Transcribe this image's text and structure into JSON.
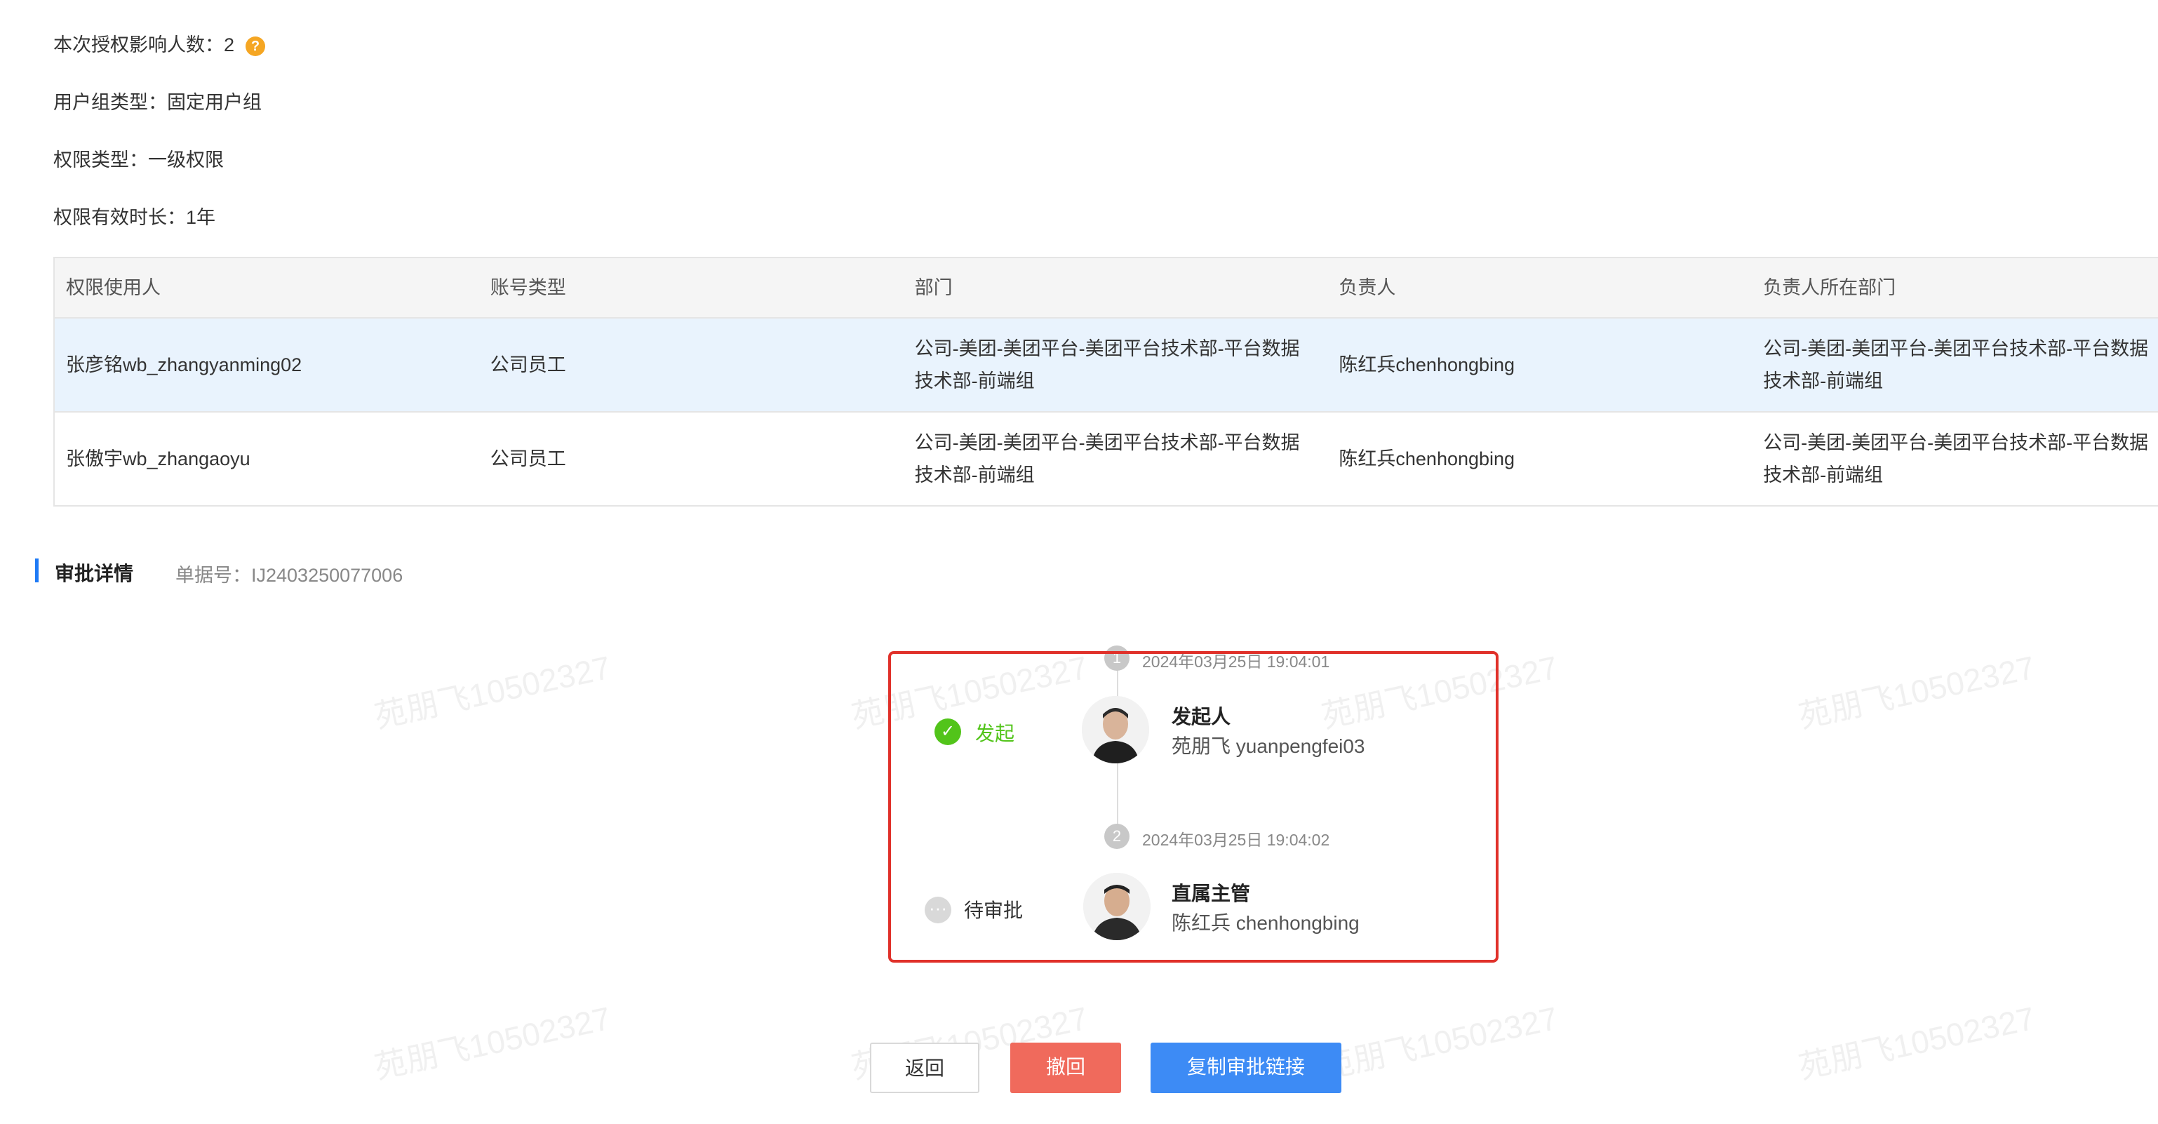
{
  "summary": {
    "affected_label": "本次授权影响人数：2",
    "group_type": "用户组类型：固定用户组",
    "perm_type": "权限类型：一级权限",
    "duration": "权限有效时长：1年"
  },
  "table": {
    "headers": [
      "权限使用人",
      "账号类型",
      "部门",
      "负责人",
      "负责人所在部门"
    ],
    "rows": [
      [
        "张彦铭wb_zhangyanming02",
        "公司员工",
        "公司-美团-美团平台-美团平台技术部-平台数据技术部-前端组",
        "陈红兵chenhongbing",
        "公司-美团-美团平台-美团平台技术部-平台数据技术部-前端组"
      ],
      [
        "张傲宇wb_zhangaoyu",
        "公司员工",
        "公司-美团-美团平台-美团平台技术部-平台数据技术部-前端组",
        "陈红兵chenhongbing",
        "公司-美团-美团平台-美团平台技术部-平台数据技术部-前端组"
      ]
    ]
  },
  "approval": {
    "title": "审批详情",
    "order_no": "单据号：IJ2403250077006",
    "steps": [
      {
        "num": "1",
        "time": "2024年03月25日 19:04:01",
        "status": "发起",
        "role": "发起人",
        "person": "苑朋飞 yuanpengfei03",
        "status_icon": "check-circle-icon"
      },
      {
        "num": "2",
        "time": "2024年03月25日 19:04:02",
        "status": "待审批",
        "role": "直属主管",
        "person": "陈红兵 chenhongbing",
        "status_icon": "pending-dots-icon"
      }
    ]
  },
  "buttons": {
    "back": "返回",
    "revoke": "撤回",
    "copy_link": "复制审批链接"
  },
  "watermark": "苑朋飞10502327",
  "colors": {
    "accent": "#3d8bf5",
    "danger": "#f06a5c",
    "success": "#52c41a",
    "highlight_border": "#e0312a",
    "selected_row": "#e9f3fd"
  }
}
